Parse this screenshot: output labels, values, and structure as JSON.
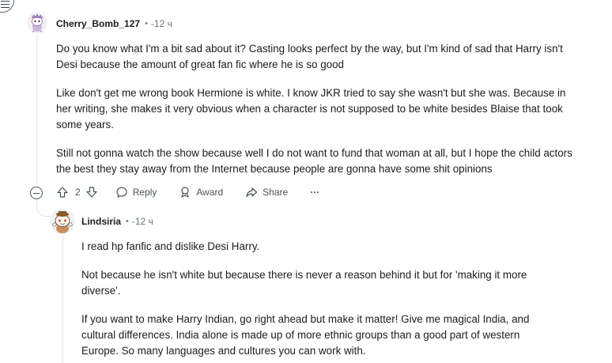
{
  "comment1": {
    "username": "Cherry_Bomb_127",
    "time": "-12 ч",
    "paragraphs": [
      "Do you know what I'm a bit sad about it? Casting looks perfect by the way, but I'm kind of sad that Harry isn't Desi because the amount of great fan fic where he is so good",
      "Like don't get me wrong book Hermione is white. I know JKR tried to say she wasn't but she was. Because in her writing, she makes it very obvious when a character is not supposed to be white besides Blaise that took some years.",
      "Still not gonna watch the show because well I do not want to fund that woman at all, but I hope the child actors the best they stay away from the Internet because people are gonna have some shit opinions"
    ],
    "upvotes": "2",
    "reply_label": "Reply",
    "award_label": "Award",
    "share_label": "Share",
    "more_label": "···"
  },
  "comment2": {
    "username": "Lindsiria",
    "time": "-12 ч",
    "paragraphs": [
      "I read hp fanfic and dislike Desi Harry.",
      "Not because he isn't white but because there is never a reason behind it but for 'making it more diverse'.",
      "If you want to make Harry Indian, go right ahead but make it matter! Give me magical India, and cultural differences. India alone is made up of more ethnic groups than a good part of western Europe. So many languages and cultures you can work with."
    ]
  },
  "separator": "•"
}
